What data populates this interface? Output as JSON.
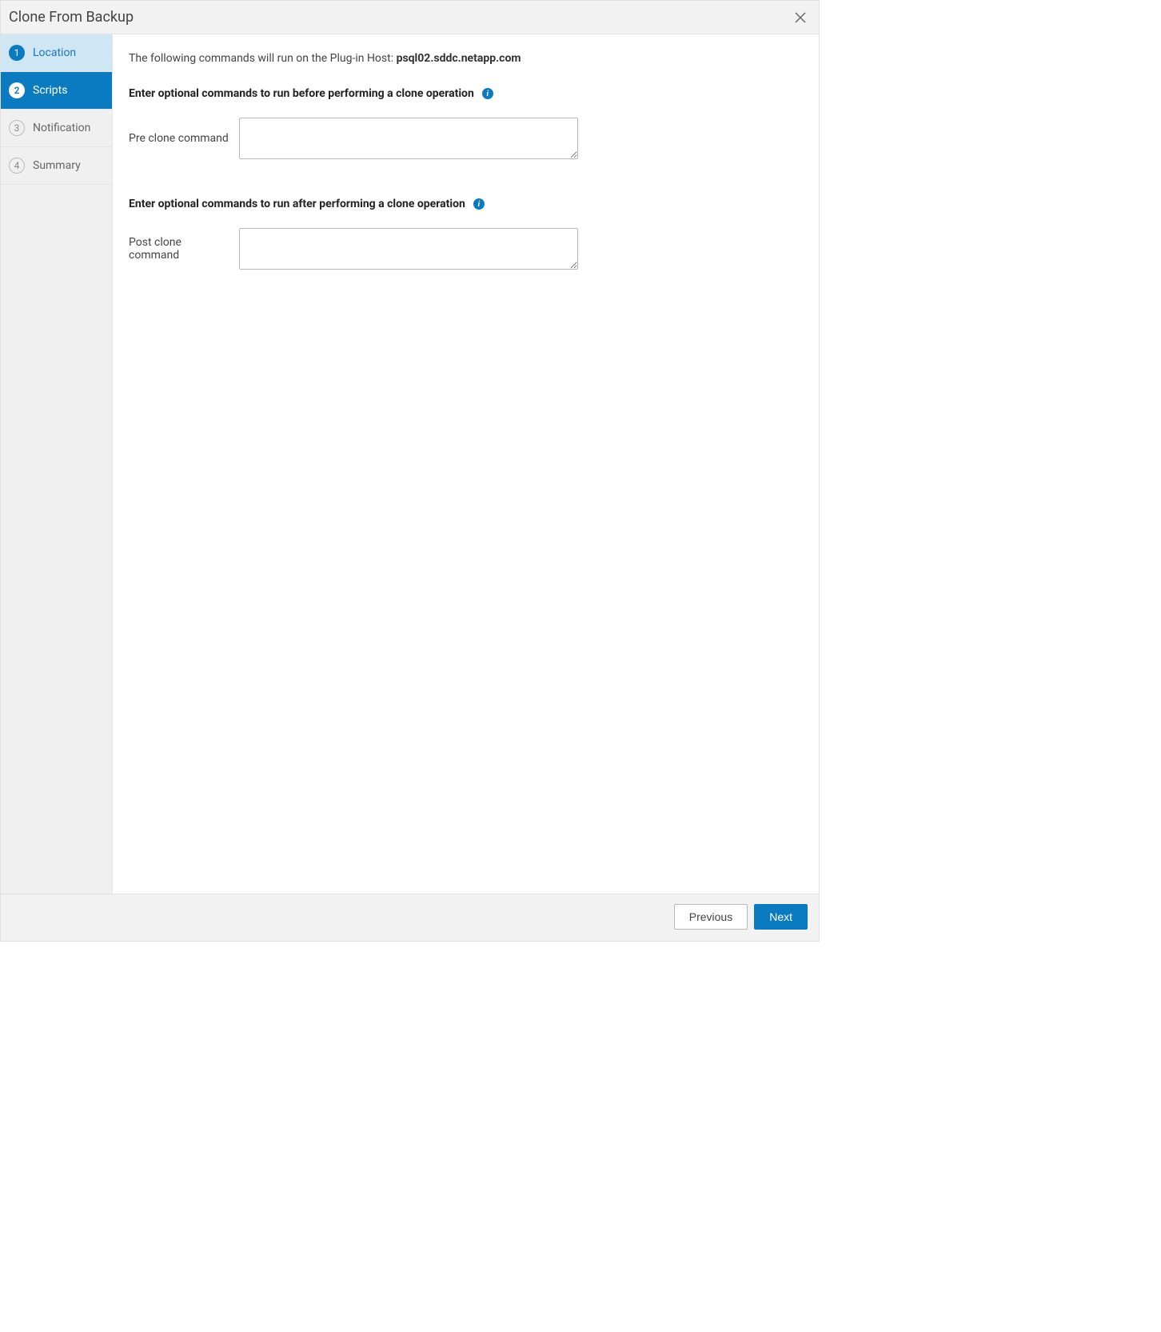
{
  "dialog": {
    "title": "Clone From Backup"
  },
  "steps": [
    {
      "num": "1",
      "label": "Location",
      "state": "completed"
    },
    {
      "num": "2",
      "label": "Scripts",
      "state": "active"
    },
    {
      "num": "3",
      "label": "Notification",
      "state": "pending"
    },
    {
      "num": "4",
      "label": "Summary",
      "state": "pending"
    }
  ],
  "content": {
    "host_line_prefix": "The following commands will run on the Plug-in Host: ",
    "host_name": "psql02.sddc.netapp.com",
    "pre_section_label": "Enter optional commands to run before performing a clone operation",
    "pre_field_label": "Pre clone command",
    "pre_field_value": "",
    "post_section_label": "Enter optional commands to run after performing a clone operation",
    "post_field_label": "Post clone command",
    "post_field_value": ""
  },
  "footer": {
    "previous": "Previous",
    "next": "Next"
  }
}
